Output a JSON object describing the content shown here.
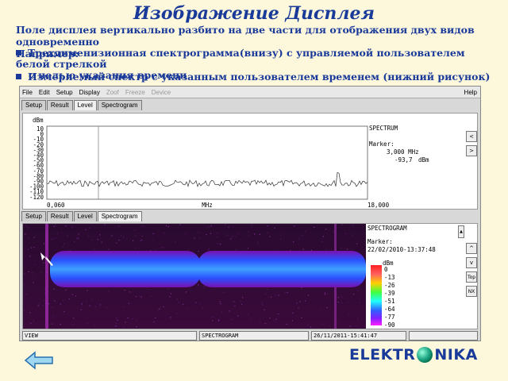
{
  "slide": {
    "title": "Изображение Дисплея",
    "intro_line1": "Поле дисплея вертикально разбито на две части для отображения двух видов одновременно",
    "intro_line2": "Например:",
    "bullet1_line1": "Трехдименизионная спектрограмма(внизу) с управляемой пользователем белой стрелкой",
    "bullet1_line2": "с целью указания времени",
    "bullet2": "Измеряемый спектр с указанным пользователем временем (нижний рисунок)",
    "logo_left": "ELEKTR",
    "logo_right": "NIKA"
  },
  "menu": {
    "items": [
      "File",
      "Edit",
      "Setup",
      "Display",
      "Zoof",
      "Freeze",
      "Device"
    ],
    "disabled": [
      false,
      false,
      false,
      false,
      true,
      true,
      true
    ],
    "help": "Help"
  },
  "tabs_top": [
    "Setup",
    "Result",
    "Level",
    "Spectrogram"
  ],
  "tabs_bottom": [
    "Setup",
    "Result",
    "Level",
    "Spectrogram"
  ],
  "spectrum": {
    "unit": "dBm",
    "y_ticks": [
      "10",
      "0",
      "-10",
      "-20",
      "-30",
      "-40",
      "-50",
      "-60",
      "-70",
      "-80",
      "-90",
      "-100",
      "-110",
      "-120"
    ],
    "x_start": "0,060",
    "x_unit": "MHz",
    "x_end": "18,000",
    "info_title": "SPECTRUM",
    "marker_label": "Marker:",
    "marker_freq": "3,000 MHz",
    "marker_level": "-93,7",
    "marker_level_unit": "dBm",
    "btn_prev": "<",
    "btn_next": ">"
  },
  "spectrogram": {
    "info_title": "SPECTROGRAM",
    "marker_label": "Marker:",
    "marker_time": "22/02/2010-13:37:48",
    "scale_unit": "dBm",
    "scale_values": [
      "0",
      "-13",
      "-26",
      "-39",
      "-51",
      "-64",
      "-77",
      "-90"
    ],
    "btn_up": "^",
    "btn_down": "v",
    "btn_top": "Top",
    "btn_nx": "NX"
  },
  "statusbar": {
    "mode": "VIEW",
    "view": "SPECTROGRAM",
    "datetime": "26/11/2011-15:41:47"
  },
  "colors": {
    "title": "#1a3a9a",
    "background": "#fdf8dc"
  }
}
